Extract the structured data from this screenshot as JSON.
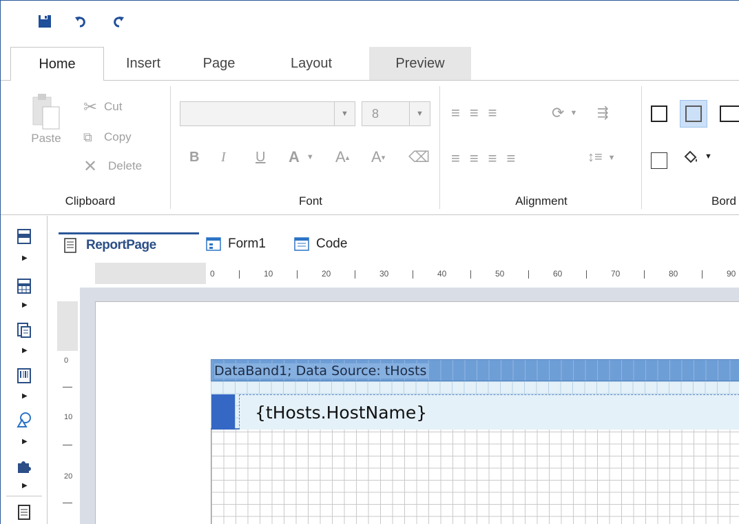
{
  "quick_access": {
    "save": "save-icon",
    "undo": "undo-icon",
    "redo": "redo-icon"
  },
  "ribbon": {
    "tabs": [
      {
        "label": "Home",
        "active": true
      },
      {
        "label": "Insert"
      },
      {
        "label": "Page"
      },
      {
        "label": "Layout"
      },
      {
        "label": "Preview"
      }
    ],
    "clipboard": {
      "paste": "Paste",
      "cut": "Cut",
      "copy": "Copy",
      "delete": "Delete",
      "label": "Clipboard"
    },
    "font": {
      "font_name": "",
      "font_size": "8",
      "bold": "B",
      "italic": "I",
      "underline": "U",
      "color": "A",
      "grow": "A",
      "shrink": "A",
      "label": "Font"
    },
    "alignment": {
      "label": "Alignment"
    },
    "border": {
      "label": "Bord"
    }
  },
  "document_tabs": [
    {
      "label": "ReportPage",
      "active": true
    },
    {
      "label": "Form1"
    },
    {
      "label": "Code"
    }
  ],
  "ruler": {
    "horizontal": [
      "0",
      "10",
      "20",
      "30",
      "40",
      "50",
      "60",
      "70",
      "80",
      "90"
    ],
    "vertical": [
      "0",
      "10",
      "20"
    ]
  },
  "canvas": {
    "band_header": "DataBand1; Data Source: tHosts",
    "text_object": "{tHosts.HostName}"
  },
  "colors": {
    "accent": "#2b579a",
    "band_header": "#6e9ed6",
    "band_body": "#e4f1f8",
    "band_handle": "#3567c4"
  }
}
